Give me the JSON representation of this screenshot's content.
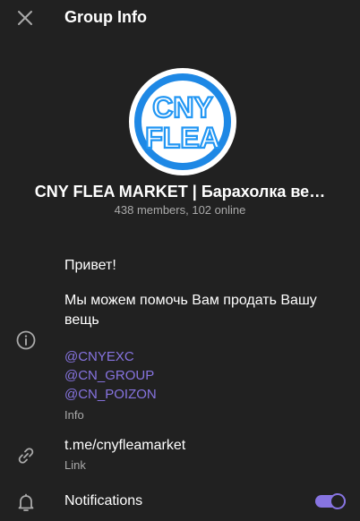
{
  "header": {
    "title": "Group Info"
  },
  "avatar": {
    "line1": "CNY",
    "line2": "FLEA",
    "ring_color": "#1e88e5",
    "text_color": "#2196f3"
  },
  "group": {
    "name": "CNY FLEA MARKET | Барахолка ве…",
    "subtitle": "438 members, 102 online"
  },
  "info": {
    "greeting": "Привет!",
    "line1": "Мы можем помочь Вам продать Вашу",
    "line2": "вещь",
    "mentions": [
      "@CNYEXC",
      "@CN_GROUP",
      "@CN_POIZON"
    ],
    "caption": "Info"
  },
  "link": {
    "value": "t.me/cnyfleamarket",
    "caption": "Link"
  },
  "notifications": {
    "label": "Notifications",
    "enabled": true
  },
  "colors": {
    "accent": "#8774e1",
    "background": "#212121",
    "secondary_text": "#aaaaaa"
  }
}
